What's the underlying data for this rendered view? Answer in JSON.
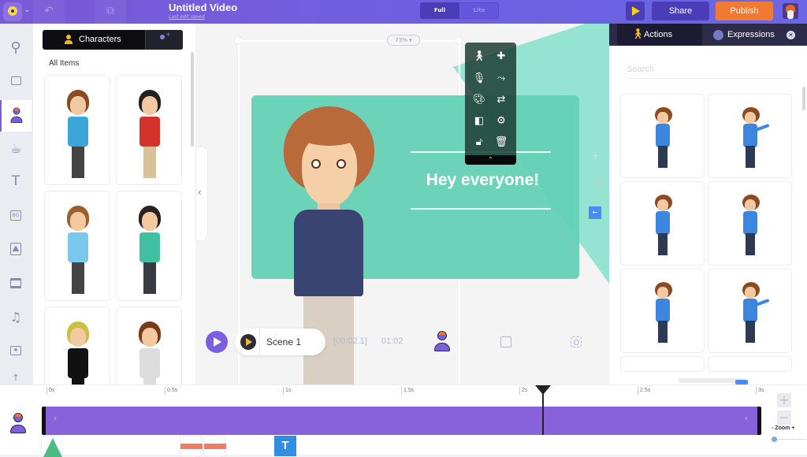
{
  "topbar": {
    "title": "Untitled Video",
    "subtitle": "Last edit saved",
    "mode_options": [
      "Full",
      "Lite"
    ],
    "mode_selected": "Full",
    "share_label": "Share",
    "publish_label": "Publish",
    "icons": [
      "logo-icon",
      "undo-icon",
      "duplicate-icon",
      "play-icon",
      "user-avatar"
    ]
  },
  "rail": {
    "items": [
      {
        "name": "search",
        "icon": "search-icon",
        "glyph": "⌕"
      },
      {
        "name": "scenes",
        "icon": "scene-icon",
        "glyph": "▭"
      },
      {
        "name": "characters",
        "icon": "character-icon",
        "glyph": "",
        "active": true
      },
      {
        "name": "props",
        "icon": "cup-icon",
        "glyph": "☕"
      },
      {
        "name": "text",
        "icon": "text-icon",
        "glyph": "T"
      },
      {
        "name": "backgrounds",
        "icon": "bg-icon",
        "glyph": "BG"
      },
      {
        "name": "images",
        "icon": "image-icon",
        "glyph": "⛰"
      },
      {
        "name": "video",
        "icon": "video-icon",
        "glyph": "▣"
      },
      {
        "name": "music",
        "icon": "music-icon",
        "glyph": "♫"
      },
      {
        "name": "effects",
        "icon": "effects-icon",
        "glyph": "✦"
      },
      {
        "name": "more",
        "icon": "arrow-up-icon",
        "glyph": "↑"
      }
    ]
  },
  "left_panel": {
    "tab_label": "Characters",
    "section_label": "All Items",
    "characters": [
      {
        "name": "woman-glasses",
        "hair": "#8a4a22",
        "top": "#3aa7d8",
        "legs": "#444"
      },
      {
        "name": "man-beard",
        "hair": "#222",
        "top": "#d4322c",
        "legs": "#d8c09a"
      },
      {
        "name": "man-tie",
        "hair": "#9a6030",
        "top": "#7cc8ec",
        "legs": "#444"
      },
      {
        "name": "woman-curly",
        "hair": "#2a2222",
        "top": "#3fc0a0",
        "legs": "#3a3a44"
      },
      {
        "name": "man-tuxedo",
        "hair": "#c8c040",
        "top": "#111",
        "legs": "#111"
      },
      {
        "name": "woman-dress",
        "hair": "#7a3a1a",
        "top": "#ddd",
        "legs": "#ddd"
      }
    ]
  },
  "canvas": {
    "zoom_level": "73%",
    "headline": "Hey everyone!",
    "scene_label": "Scene 1",
    "time_current": "[00:02.1]",
    "time_total": "01:02",
    "toolbox_icons": [
      "walk-icon",
      "add-action-icon",
      "mic-icon",
      "path-icon",
      "palette-icon",
      "swap-icon",
      "opacity-icon",
      "settings-icon",
      "unlock-icon",
      "trash-icon"
    ],
    "colors": {
      "card": "#64d1b5",
      "accent": "#7b5fe0"
    }
  },
  "right_panel": {
    "tabs": [
      {
        "label": "Actions",
        "active": true
      },
      {
        "label": "Expressions",
        "active": false
      }
    ],
    "search_placeholder": "Search",
    "actions": [
      "idle",
      "present-right",
      "stand",
      "hands-on-head",
      "point",
      "present-talk"
    ]
  },
  "timeline": {
    "ticks": [
      "0s",
      "0.5s",
      "1s",
      "1.5s",
      "2s",
      "2.5s",
      "3s"
    ],
    "playhead_time_s": 2.1,
    "zoom_label": "Zoom",
    "zoom_minus": "-",
    "zoom_plus": "+",
    "text_element_label": "T"
  }
}
